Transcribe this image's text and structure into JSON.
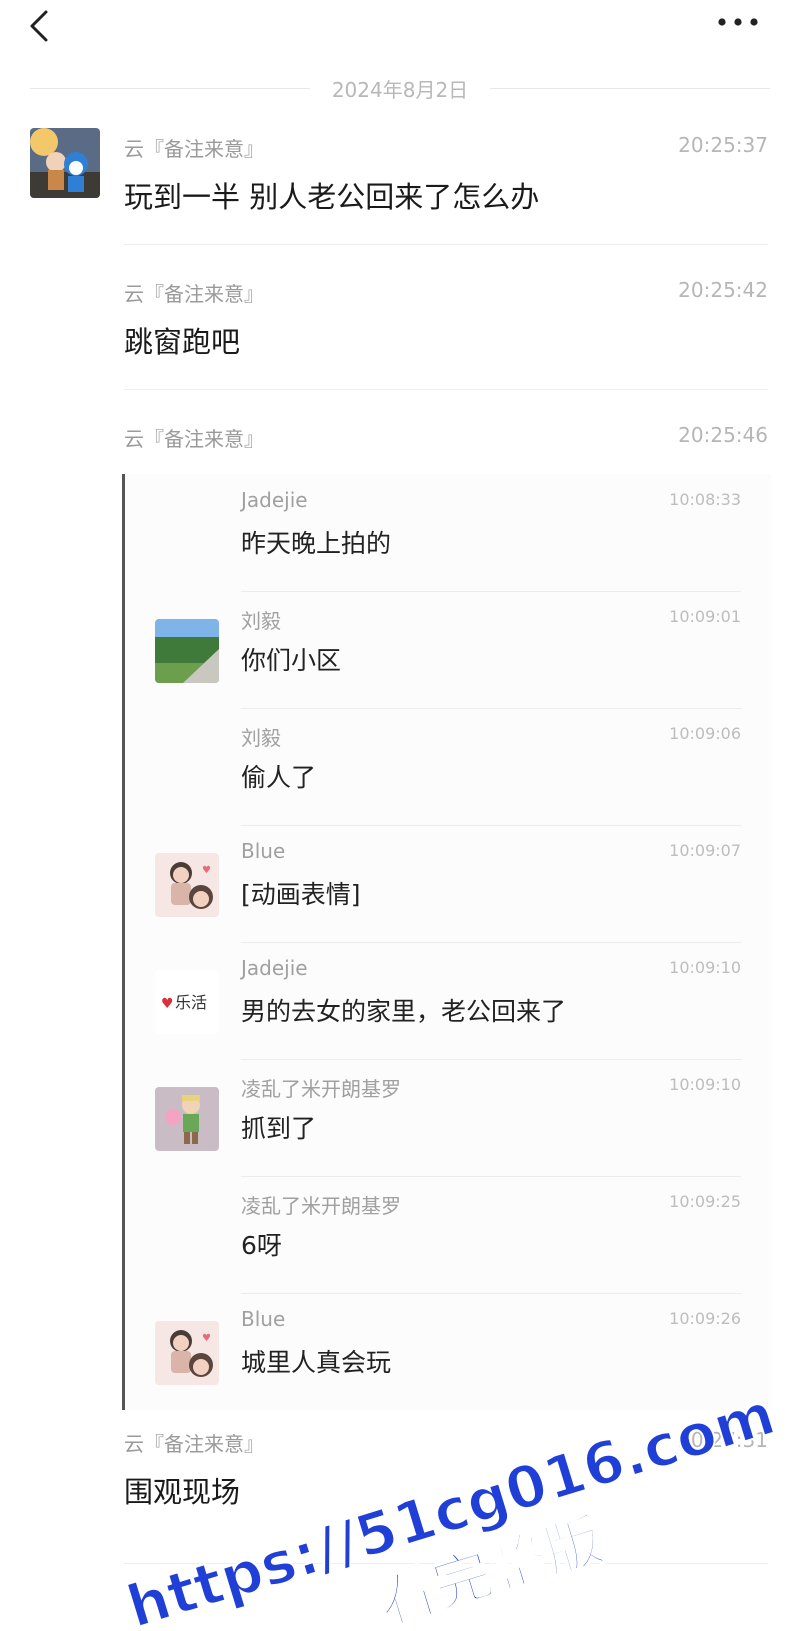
{
  "header": {
    "back_icon": "chevron-left-icon",
    "more_icon": "more-horizontal-icon"
  },
  "date_separator": "2024年8月2日",
  "messages": [
    {
      "sender": "云『备注来意』",
      "time": "20:25:37",
      "text": "玩到一半 别人老公回来了怎么办"
    },
    {
      "sender": "云『备注来意』",
      "time": "20:25:42",
      "text": "跳窗跑吧"
    },
    {
      "sender": "云『备注来意』",
      "time": "20:25:46"
    },
    {
      "sender": "云『备注来意』",
      "time": "20:27:31",
      "text": "围观现场"
    }
  ],
  "forwarded": [
    {
      "name": "Jadejie",
      "time": "10:08:33",
      "text": "昨天晚上拍的",
      "avatar": ""
    },
    {
      "name": "刘毅",
      "time": "10:09:01",
      "text": "你们小区",
      "avatar": "road"
    },
    {
      "name": "刘毅",
      "time": "10:09:06",
      "text": "偷人了",
      "avatar": ""
    },
    {
      "name": "Blue",
      "time": "10:09:07",
      "text": "[动画表情]",
      "avatar": "cartoon"
    },
    {
      "name": "Jadejie",
      "time": "10:09:10",
      "text": "男的去女的家里，老公回来了",
      "avatar": "logo"
    },
    {
      "name": "凌乱了米开朗基罗",
      "time": "10:09:10",
      "text": "抓到了",
      "avatar": "kid"
    },
    {
      "name": "凌乱了米开朗基罗",
      "time": "10:09:25",
      "text": "6呀",
      "avatar": ""
    },
    {
      "name": "Blue",
      "time": "10:09:26",
      "text": "城里人真会玩",
      "avatar": "cartoon"
    }
  ],
  "logo_text": "乐活",
  "watermark": {
    "line1": "https://51cg016.com",
    "line2": "看完整版",
    "color": "#1f3fd6"
  }
}
